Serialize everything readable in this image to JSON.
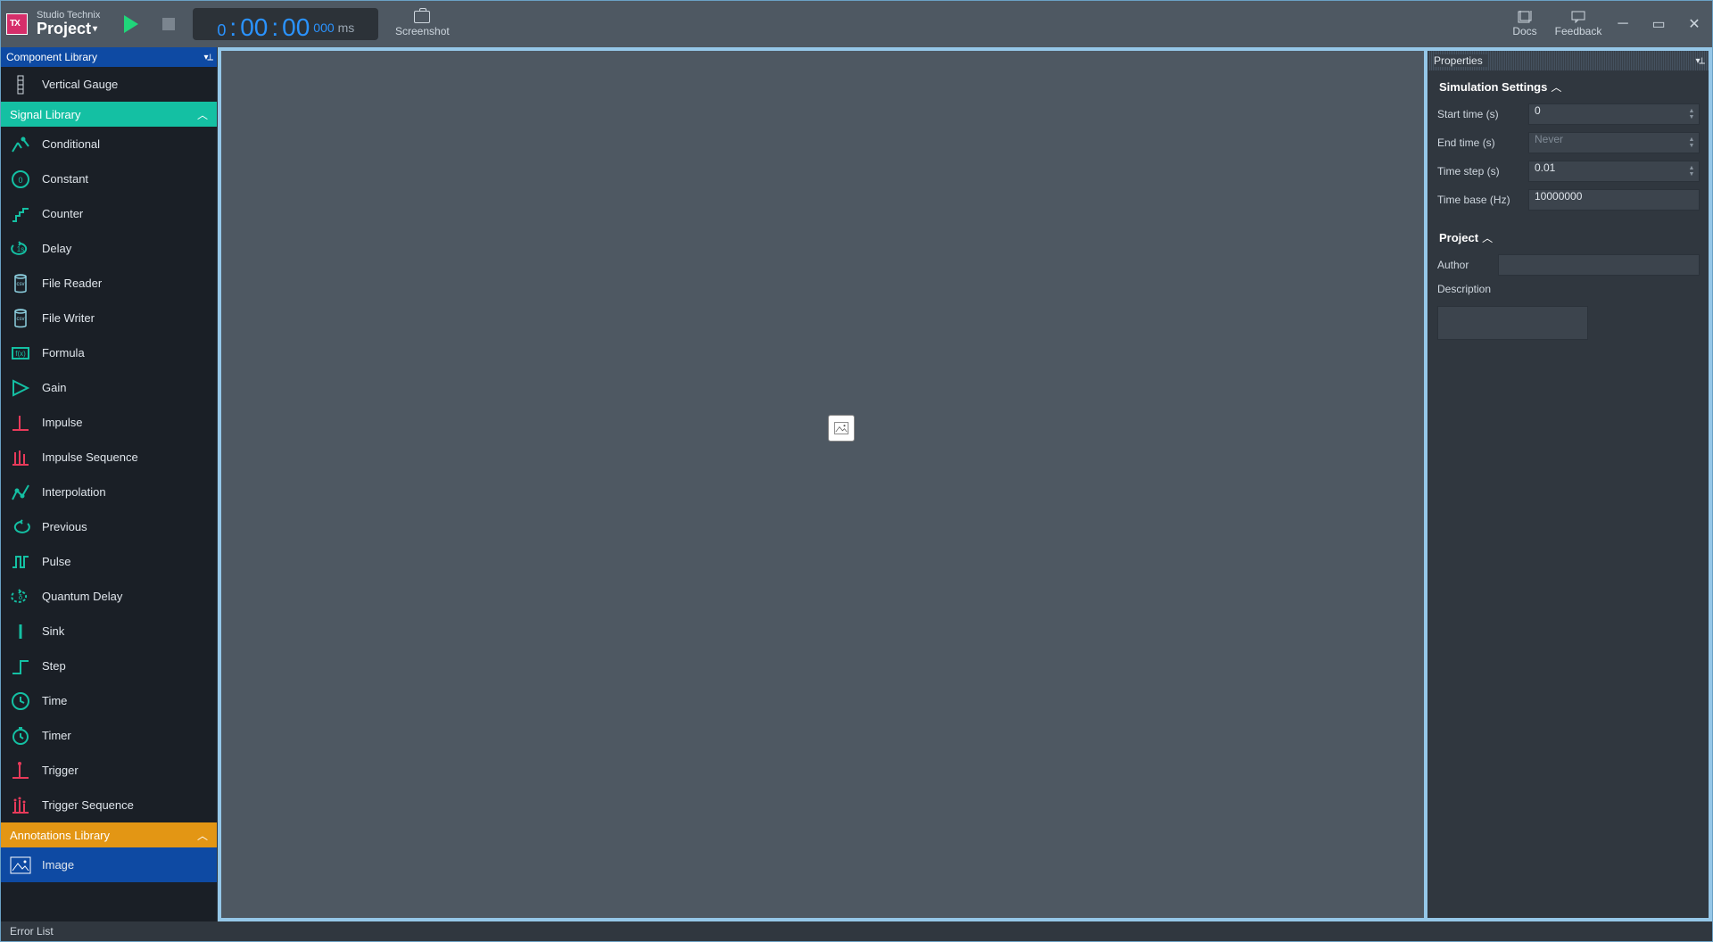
{
  "brand": {
    "small": "Studio Technix",
    "big": "Project"
  },
  "time": {
    "lead": "0",
    "mm": "00",
    "ss": "00",
    "sub": "000",
    "unit": "ms"
  },
  "toolbar": {
    "screenshot": "Screenshot"
  },
  "header_links": {
    "docs": "Docs",
    "feedback": "Feedback"
  },
  "sidebar": {
    "panel_title": "Component Library",
    "vertical_gauge": "Vertical Gauge",
    "signal_hdr": "Signal Library",
    "signal_items": [
      "Conditional",
      "Constant",
      "Counter",
      "Delay",
      "File Reader",
      "File Writer",
      "Formula",
      "Gain",
      "Impulse",
      "Impulse Sequence",
      "Interpolation",
      "Previous",
      "Pulse",
      "Quantum Delay",
      "Sink",
      "Step",
      "Time",
      "Timer",
      "Trigger",
      "Trigger Sequence"
    ],
    "annot_hdr": "Annotations Library",
    "annot_items": [
      "Image"
    ]
  },
  "properties": {
    "panel_title": "Properties",
    "sim_title": "Simulation Settings",
    "start_label": "Start time (s)",
    "start_value": "0",
    "end_label": "End time (s)",
    "end_placeholder": "Never",
    "step_label": "Time step (s)",
    "step_value": "0.01",
    "base_label": "Time base (Hz)",
    "base_value": "10000000",
    "project_title": "Project",
    "author_label": "Author",
    "author_value": "",
    "desc_label": "Description",
    "desc_value": ""
  },
  "status": {
    "error_list": "Error List"
  }
}
